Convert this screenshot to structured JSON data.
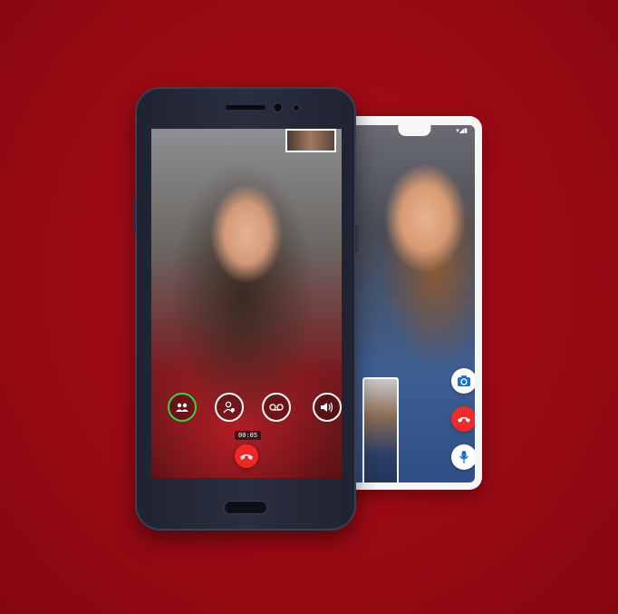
{
  "colors": {
    "background": "#9a0a14",
    "hangup": "#ef2b2b",
    "active_ring": "#3ad14b",
    "accent_blue": "#1e6fd9"
  },
  "front_phone": {
    "call_timer": "00:05",
    "controls": [
      {
        "icon": "group-call-icon",
        "active": true
      },
      {
        "icon": "add-user-icon",
        "active": false
      },
      {
        "icon": "voicemail-icon",
        "active": false
      },
      {
        "icon": "speaker-icon",
        "active": false
      }
    ],
    "hangup_icon": "phone-hangup-icon"
  },
  "back_phone": {
    "buttons": [
      {
        "icon": "switch-camera-icon"
      },
      {
        "icon": "phone-hangup-icon"
      },
      {
        "icon": "microphone-icon"
      }
    ]
  }
}
